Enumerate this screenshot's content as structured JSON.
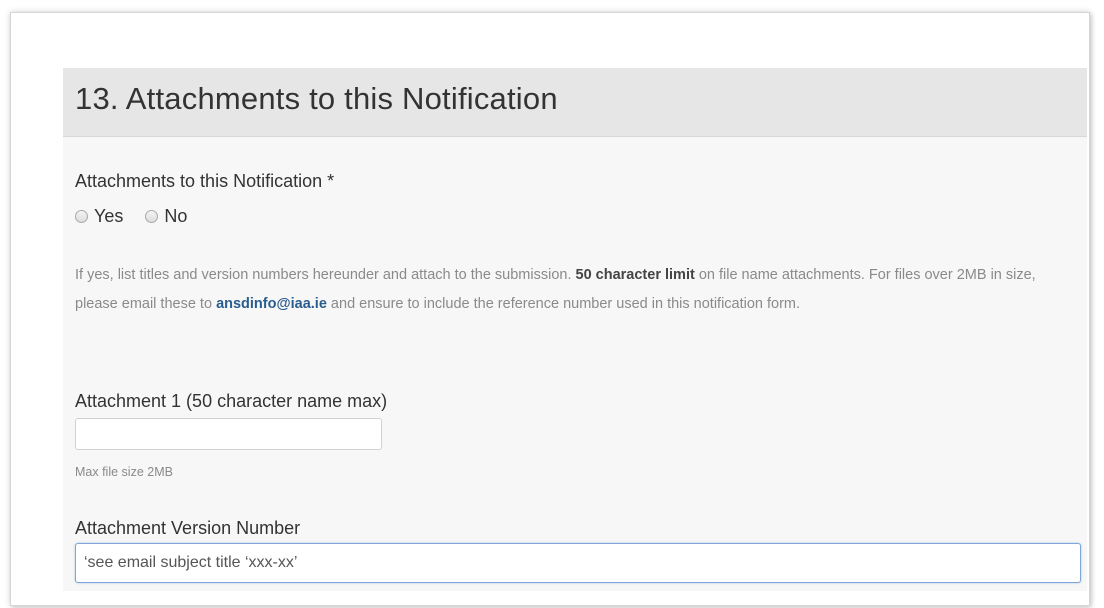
{
  "section": {
    "title": "13. Attachments to this Notification"
  },
  "attachments_question": {
    "label": "Attachments to this Notification *",
    "options": [
      {
        "label": "Yes",
        "selected": false
      },
      {
        "label": "No",
        "selected": false
      }
    ]
  },
  "help": {
    "text_before_limit": "If yes, list titles and version numbers hereunder and attach to the submission. ",
    "limit_emphasis": "50 character limit",
    "text_after_limit": " on file name attachments. For files over 2MB in size, please email these to ",
    "email": "ansdinfo@iaa.ie",
    "text_after_email": " and ensure to include the reference number used in this notification form."
  },
  "attachment_1": {
    "label": "Attachment 1 (50 character name max)",
    "value": "",
    "hint": "Max file size 2MB"
  },
  "attachment_version": {
    "label": "Attachment Version Number",
    "value": "‘see email subject title ‘xxx-xx’"
  },
  "colors": {
    "header_background": "#e6e6e6",
    "panel_background": "#f7f7f7",
    "link": "#2a5d8f",
    "focus_border": "#7fa6d8"
  }
}
